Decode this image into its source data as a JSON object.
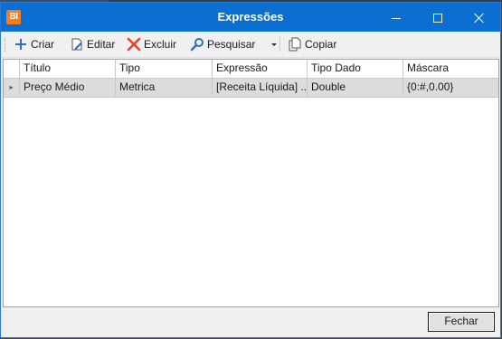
{
  "window": {
    "app_icon_text": "BI",
    "title": "Expressões"
  },
  "toolbar": {
    "criar": "Criar",
    "editar": "Editar",
    "excluir": "Excluir",
    "pesquisar": "Pesquisar",
    "copiar": "Copiar"
  },
  "grid": {
    "columns": [
      "Título",
      "Tipo",
      "Expressão",
      "Tipo Dado",
      "Máscara"
    ],
    "rows": [
      {
        "indicator": "▸",
        "cells": [
          "Preço Médio",
          "Metrica",
          "[Receita Líquida]   ...",
          "Double",
          "{0:#,0.00}"
        ]
      }
    ]
  },
  "footer": {
    "close_label": "Fechar"
  },
  "colors": {
    "titlebar": "#0a6fd0",
    "app_icon": "#ff7a1a",
    "delete_icon": "#e8402a",
    "add_icon": "#2f6fb8",
    "selected_row": "#dcdcdc"
  },
  "icons": [
    "bi-app-icon",
    "minimize-icon",
    "maximize-icon",
    "close-icon",
    "plus-icon",
    "edit-icon",
    "delete-x-icon",
    "search-icon",
    "dropdown-arrow-icon",
    "copy-icon",
    "row-indicator-icon"
  ]
}
